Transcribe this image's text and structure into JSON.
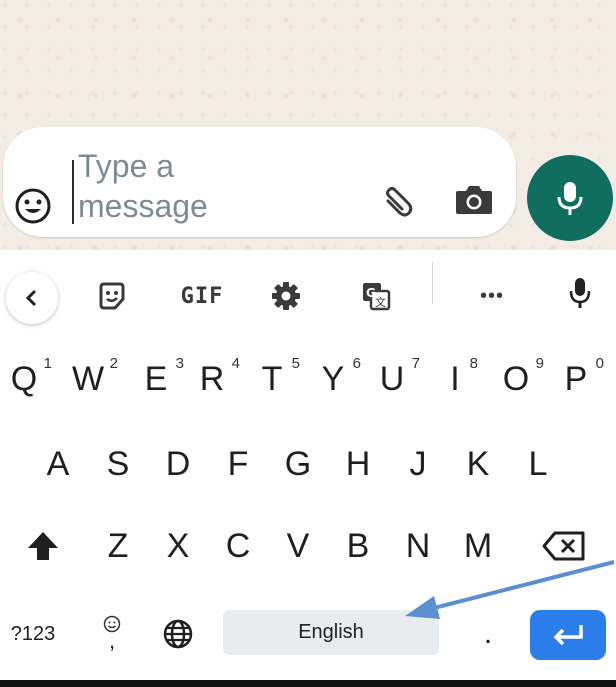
{
  "composer": {
    "placeholder": "Type a message",
    "placeholder_line1": "Type a",
    "placeholder_line2": "message"
  },
  "colors": {
    "mic_fab": "#0f6e5e",
    "enter_key": "#2b7de9",
    "space_bar": "#e8ecef",
    "annotation_arrow": "#5a8fd0"
  },
  "toolbar": {
    "back_icon": "chevron-left-icon",
    "sticker_icon": "sticker-icon",
    "gif_label": "GIF",
    "settings_icon": "gear-icon",
    "translate_icon": "translate-icon",
    "more_label": "•••",
    "voice_icon": "mic-icon"
  },
  "keyboard": {
    "row1": [
      {
        "key": "Q",
        "hint": "1"
      },
      {
        "key": "W",
        "hint": "2"
      },
      {
        "key": "E",
        "hint": "3"
      },
      {
        "key": "R",
        "hint": "4"
      },
      {
        "key": "T",
        "hint": "5"
      },
      {
        "key": "Y",
        "hint": "6"
      },
      {
        "key": "U",
        "hint": "7"
      },
      {
        "key": "I",
        "hint": "8"
      },
      {
        "key": "O",
        "hint": "9"
      },
      {
        "key": "P",
        "hint": "0"
      }
    ],
    "row2": [
      "A",
      "S",
      "D",
      "F",
      "G",
      "H",
      "J",
      "K",
      "L"
    ],
    "row3": [
      "Z",
      "X",
      "C",
      "V",
      "B",
      "N",
      "M"
    ],
    "symbols_key": "?123",
    "comma_key": ",",
    "emoji_key_icon": "smiley-icon",
    "language_key_icon": "globe-icon",
    "space_label": "English",
    "period_key": ".",
    "shift_icon": "shift-icon",
    "backspace_icon": "backspace-icon",
    "enter_icon": "enter-icon"
  }
}
